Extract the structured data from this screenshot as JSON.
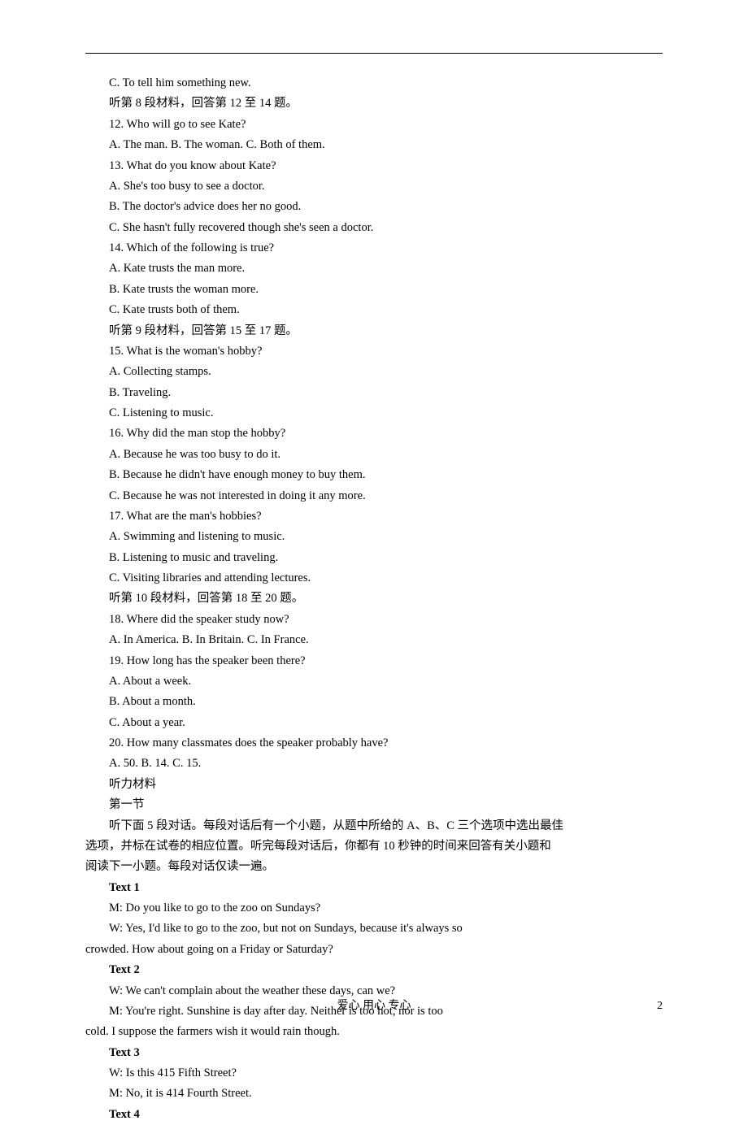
{
  "lines": [
    {
      "cls": "indent",
      "bold": false,
      "text": "C. To tell him something new."
    },
    {
      "cls": "indent",
      "bold": false,
      "text": "听第 8 段材料，回答第 12 至 14 题。"
    },
    {
      "cls": "indent",
      "bold": false,
      "text": "12. Who will go to see Kate?"
    },
    {
      "cls": "indent",
      "bold": false,
      "text": "A. The man.  B. The woman.  C. Both of them."
    },
    {
      "cls": "indent",
      "bold": false,
      "text": "13. What do you know about Kate?"
    },
    {
      "cls": "indent",
      "bold": false,
      "text": "A. She's too busy to see a doctor."
    },
    {
      "cls": "indent",
      "bold": false,
      "text": "B. The doctor's advice does her no good."
    },
    {
      "cls": "indent",
      "bold": false,
      "text": "C. She hasn't fully recovered though she's seen a doctor."
    },
    {
      "cls": "indent",
      "bold": false,
      "text": "14. Which of the following is true?"
    },
    {
      "cls": "indent",
      "bold": false,
      "text": "A. Kate trusts the man more."
    },
    {
      "cls": "indent",
      "bold": false,
      "text": "B. Kate trusts the woman more."
    },
    {
      "cls": "indent",
      "bold": false,
      "text": "C. Kate trusts both of them."
    },
    {
      "cls": "indent",
      "bold": false,
      "text": "听第 9 段材料，回答第 15 至 17 题。"
    },
    {
      "cls": "indent",
      "bold": false,
      "text": "15. What is the woman's hobby?"
    },
    {
      "cls": "indent",
      "bold": false,
      "text": "A. Collecting stamps."
    },
    {
      "cls": "indent",
      "bold": false,
      "text": "B. Traveling."
    },
    {
      "cls": "indent",
      "bold": false,
      "text": "C. Listening to music."
    },
    {
      "cls": "indent",
      "bold": false,
      "text": "16. Why did the man stop the hobby?"
    },
    {
      "cls": "indent",
      "bold": false,
      "text": "A. Because he was too busy to do it."
    },
    {
      "cls": "indent",
      "bold": false,
      "text": "B. Because he didn't have enough money to buy them."
    },
    {
      "cls": "indent",
      "bold": false,
      "text": "C. Because he was not interested in doing it any more."
    },
    {
      "cls": "indent",
      "bold": false,
      "text": "17. What are the man's hobbies?"
    },
    {
      "cls": "indent",
      "bold": false,
      "text": "A. Swimming and listening to music."
    },
    {
      "cls": "indent",
      "bold": false,
      "text": "B. Listening to music and traveling."
    },
    {
      "cls": "indent",
      "bold": false,
      "text": "C. Visiting libraries and attending lectures."
    },
    {
      "cls": "indent",
      "bold": false,
      "text": "听第 10 段材料，回答第 18 至 20 题。"
    },
    {
      "cls": "indent",
      "bold": false,
      "text": "18. Where did the speaker study now?"
    },
    {
      "cls": "indent",
      "bold": false,
      "text": "A. In America.  B. In Britain.  C. In France."
    },
    {
      "cls": "indent",
      "bold": false,
      "text": "19. How long has the speaker been there?"
    },
    {
      "cls": "indent",
      "bold": false,
      "text": "A. About a week."
    },
    {
      "cls": "indent",
      "bold": false,
      "text": "B. About a month."
    },
    {
      "cls": "indent",
      "bold": false,
      "text": "C. About a year."
    },
    {
      "cls": "indent",
      "bold": false,
      "text": "20. How many classmates does the speaker probably have?"
    },
    {
      "cls": "indent",
      "bold": false,
      "text": "A. 50.  B. 14.  C. 15."
    },
    {
      "cls": "indent",
      "bold": false,
      "text": "听力材料"
    },
    {
      "cls": "indent",
      "bold": false,
      "text": "第一节"
    },
    {
      "cls": "indent",
      "bold": false,
      "text": "听下面 5 段对话。每段对话后有一个小题，从题中所给的 A、B、C 三个选项中选出最佳"
    },
    {
      "cls": "noindent",
      "bold": false,
      "text": "选项，并标在试卷的相应位置。听完每段对话后，你都有 10 秒钟的时间来回答有关小题和"
    },
    {
      "cls": "noindent",
      "bold": false,
      "text": "阅读下一小题。每段对话仅读一遍。"
    },
    {
      "cls": "indent",
      "bold": true,
      "text": "Text 1"
    },
    {
      "cls": "indent",
      "bold": false,
      "text": "M: Do you like to go to the zoo on Sundays?"
    },
    {
      "cls": "indent",
      "bold": false,
      "text": "W: Yes, I'd like to go to the zoo, but not on Sundays, because it's always so"
    },
    {
      "cls": "noindent",
      "bold": false,
      "text": "crowded. How about going on a Friday or Saturday?"
    },
    {
      "cls": "indent",
      "bold": true,
      "text": "Text 2"
    },
    {
      "cls": "indent",
      "bold": false,
      "text": "W: We can't complain about the weather these days, can we?"
    },
    {
      "cls": "indent",
      "bold": false,
      "text": "M: You're right. Sunshine is day after day. Neither is too hot, nor is too"
    },
    {
      "cls": "noindent",
      "bold": false,
      "text": "cold. I suppose the farmers wish it would rain though."
    },
    {
      "cls": "indent",
      "bold": true,
      "text": "Text 3"
    },
    {
      "cls": "indent",
      "bold": false,
      "text": "W: Is this 415 Fifth Street?"
    },
    {
      "cls": "indent",
      "bold": false,
      "text": "M: No, it is 414 Fourth Street."
    },
    {
      "cls": "indent",
      "bold": true,
      "text": "Text 4"
    }
  ],
  "footer": {
    "motto": "爱心    用心    专心",
    "page": "2"
  }
}
